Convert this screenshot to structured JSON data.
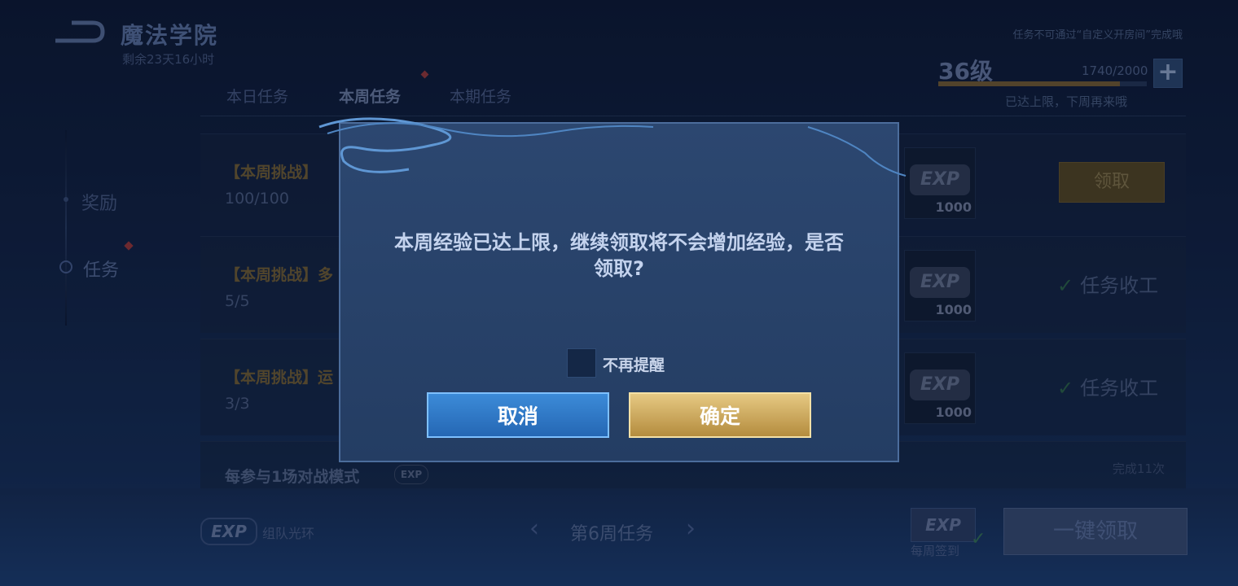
{
  "header": {
    "title": "魔法学院",
    "remaining": "剩余23天16小时",
    "notice": "任务不可通过“自定义开房间”完成哦"
  },
  "level": {
    "label": "36级",
    "exp_current": 1740,
    "exp_max": 2000,
    "exp_text": "1740/2000",
    "plus": "+",
    "limit_note": "已达上限，下周再来哦"
  },
  "tabs": [
    {
      "label": "本日任务"
    },
    {
      "label": "本周任务"
    },
    {
      "label": "本期任务"
    }
  ],
  "sidebar": {
    "items": [
      {
        "label": "奖励"
      },
      {
        "label": "任务"
      }
    ]
  },
  "tasks": [
    {
      "title": "【本周挑战】",
      "progress": "100/100",
      "reward": "1000",
      "action": "领取"
    },
    {
      "title": "【本周挑战】多",
      "progress": "5/5",
      "reward": "1000",
      "action": "任务收工"
    },
    {
      "title": "【本周挑战】运",
      "progress": "3/3",
      "reward": "1000",
      "action": "任务收工"
    },
    {
      "title": "每参与1场对战模式",
      "count": "完成11次"
    }
  ],
  "exp_badge": "EXP",
  "bottom": {
    "team_label": "组队光环",
    "week_label": "第6周任务",
    "prev": "‹",
    "next": "›",
    "weekly_label": "每周签到",
    "oneclick": "一键领取"
  },
  "dialog": {
    "message": "本周经验已达上限，继续领取将不会增加经验，是否领取?",
    "checkbox_label": "不再提醒",
    "cancel": "取消",
    "confirm": "确定"
  },
  "colors": {
    "accent_gold": "#d9b96a",
    "accent_blue": "#3c8bd8"
  }
}
